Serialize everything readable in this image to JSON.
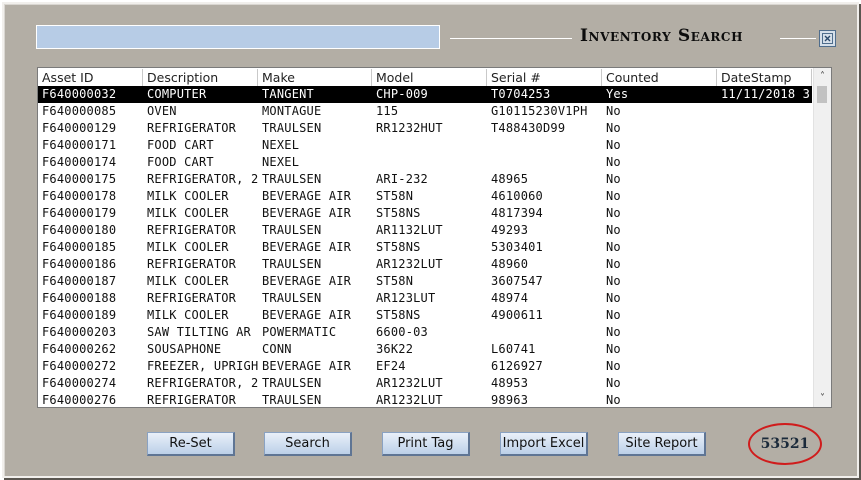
{
  "header": {
    "title": "Inventory Search",
    "search_value": "",
    "close_icon": "close-icon"
  },
  "table": {
    "columns": [
      "Asset ID",
      "Description",
      "Make",
      "Model",
      "Serial #",
      "Counted",
      "DateStamp"
    ],
    "rows": [
      [
        "F640000032",
        "COMPUTER",
        "TANGENT",
        "CHP-009",
        "T0704253",
        "Yes",
        "11/11/2018 3"
      ],
      [
        "F640000085",
        "OVEN",
        "MONTAGUE",
        "115",
        "G10115230V1PH",
        "No",
        ""
      ],
      [
        "F640000129",
        "REFRIGERATOR",
        "TRAULSEN",
        "RR1232HUT",
        "T488430D99",
        "No",
        ""
      ],
      [
        "F640000171",
        "FOOD CART",
        "NEXEL",
        "",
        "",
        "No",
        ""
      ],
      [
        "F640000174",
        "FOOD CART",
        "NEXEL",
        "",
        "",
        "No",
        ""
      ],
      [
        "F640000175",
        "REFRIGERATOR, 2",
        "TRAULSEN",
        "ARI-232",
        "48965",
        "No",
        ""
      ],
      [
        "F640000178",
        "MILK COOLER",
        "BEVERAGE AIR",
        "ST58N",
        "4610060",
        "No",
        ""
      ],
      [
        "F640000179",
        "MILK COOLER",
        "BEVERAGE AIR",
        "ST58NS",
        "4817394",
        "No",
        ""
      ],
      [
        "F640000180",
        "REFRIGERATOR",
        "TRAULSEN",
        "AR1132LUT",
        "49293",
        "No",
        ""
      ],
      [
        "F640000185",
        "MILK COOLER",
        "BEVERAGE AIR",
        "ST58NS",
        "5303401",
        "No",
        ""
      ],
      [
        "F640000186",
        "REFRIGERATOR",
        "TRAULSEN",
        "AR1232LUT",
        "48960",
        "No",
        ""
      ],
      [
        "F640000187",
        "MILK COOLER",
        "BEVERAGE AIR",
        "ST58N",
        "3607547",
        "No",
        ""
      ],
      [
        "F640000188",
        "REFRIGERATOR",
        "TRAULSEN",
        "AR123LUT",
        "48974",
        "No",
        ""
      ],
      [
        "F640000189",
        "MILK COOLER",
        "BEVERAGE AIR",
        "ST58NS",
        "4900611",
        "No",
        ""
      ],
      [
        "F640000203",
        "SAW TILTING AR",
        "POWERMATIC",
        "6600-03",
        "",
        "No",
        ""
      ],
      [
        "F640000262",
        "SOUSAPHONE",
        "CONN",
        "36K22",
        "L60741",
        "No",
        ""
      ],
      [
        "F640000272",
        "FREEZER, UPRIGH",
        "BEVERAGE AIR",
        "EF24",
        "6126927",
        "No",
        ""
      ],
      [
        "F640000274",
        "REFRIGERATOR, 2",
        "TRAULSEN",
        "AR1232LUT",
        "48953",
        "No",
        ""
      ],
      [
        "F640000276",
        "REFRIGERATOR",
        "TRAULSEN",
        "AR1232LUT",
        "98963",
        "No",
        ""
      ]
    ],
    "selected_row": 0
  },
  "buttons": {
    "reset": "Re-Set",
    "search": "Search",
    "print_tag": "Print Tag",
    "import_excel": "Import Excel",
    "site_report": "Site Report"
  },
  "count": "53521",
  "colors": {
    "background": "#b3aea5",
    "search_box": "#b7cce6",
    "selected_row": "#000000",
    "count_circle": "#d01c1c"
  }
}
